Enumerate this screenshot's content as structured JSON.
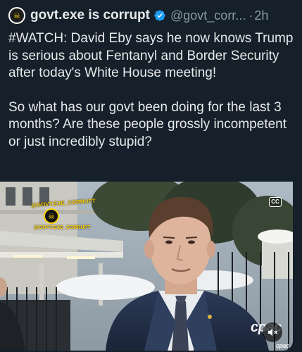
{
  "tweet": {
    "author_name": "govt.exe is corrupt",
    "handle": "@govt_corr...",
    "separator": "·",
    "time": "2h",
    "paragraph1": "#WATCH: David Eby says he now knows Trump is serious about Fentanyl and Border Security after today's White House meeting!",
    "paragraph2": "So what has our govt been doing for the last 3 months? Are these people grossly incompetent or just incredibly stupid?"
  },
  "media": {
    "watermark_top": "@GOVT.EXE_CORRUPT",
    "watermark_bottom": "@GOVT.EXE_CORRUPT",
    "cc_label": "CC",
    "broadcaster": "cpac",
    "broadcaster_small": "cpac"
  },
  "colors": {
    "background": "#15202b",
    "verified_badge": "#1d9bf0",
    "watermark": "#ffd400"
  },
  "icons": [
    "verified-badge-icon",
    "closed-captions-icon",
    "volume-muted-icon"
  ]
}
